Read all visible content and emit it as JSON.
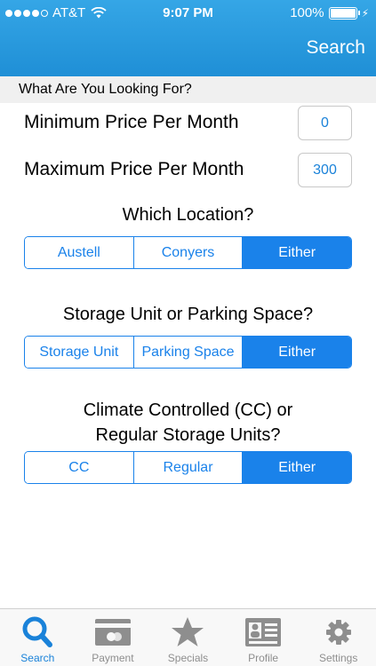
{
  "status_bar": {
    "carrier": "AT&T",
    "time": "9:07 PM",
    "battery": "100%"
  },
  "nav": {
    "search_label": "Search"
  },
  "section_header": "What Are You Looking For?",
  "price": {
    "min_label": "Minimum Price Per Month",
    "min_value": "0",
    "max_label": "Maximum Price Per Month",
    "max_value": "300"
  },
  "location": {
    "question": "Which Location?",
    "options": [
      "Austell",
      "Conyers",
      "Either"
    ],
    "selected": "Either"
  },
  "storage_type": {
    "question": "Storage Unit or Parking Space?",
    "options": [
      "Storage Unit",
      "Parking Space",
      "Either"
    ],
    "selected": "Either"
  },
  "climate": {
    "question_line1": "Climate Controlled (CC) or",
    "question_line2": "Regular Storage Units?",
    "options": [
      "CC",
      "Regular",
      "Either"
    ],
    "selected": "Either"
  },
  "tabs": [
    {
      "label": "Search",
      "icon": "search-icon",
      "active": true
    },
    {
      "label": "Payment",
      "icon": "payment-icon",
      "active": false
    },
    {
      "label": "Specials",
      "icon": "star-icon",
      "active": false
    },
    {
      "label": "Profile",
      "icon": "profile-card-icon",
      "active": false
    },
    {
      "label": "Settings",
      "icon": "gear-icon",
      "active": false
    }
  ],
  "colors": {
    "header": "#2b9ce0",
    "accent": "#1a82ea",
    "tab_inactive": "#8e8e8e"
  }
}
